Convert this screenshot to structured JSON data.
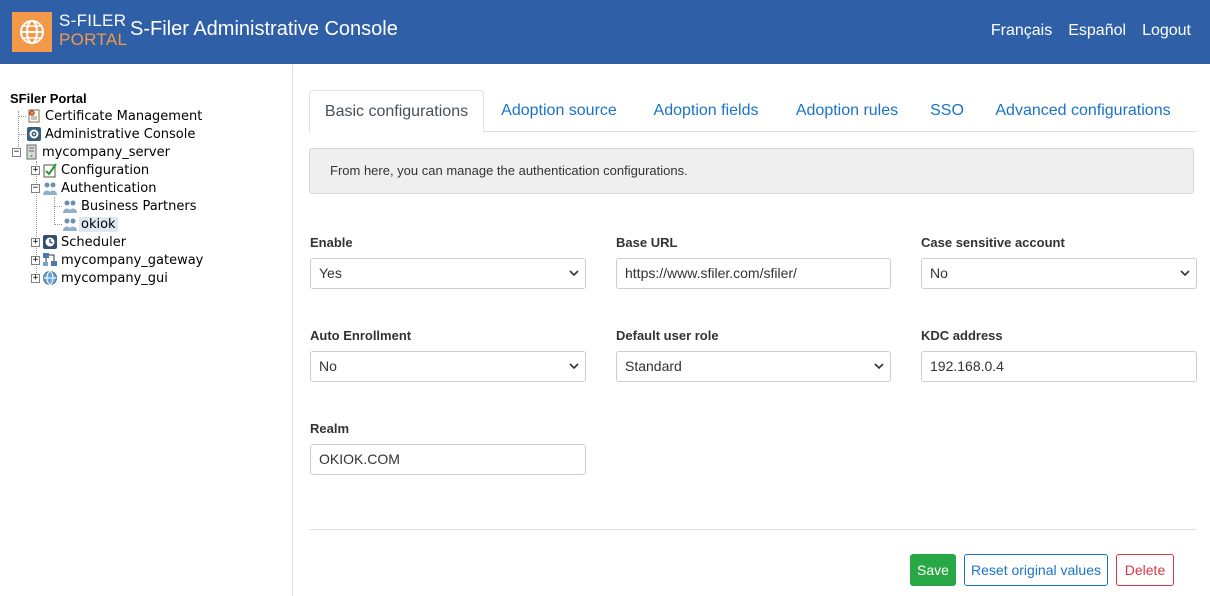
{
  "header": {
    "logo_line1": "S-FILER",
    "logo_line2": "PORTAL",
    "title": "S-Filer Administrative Console",
    "nav": [
      "Français",
      "Español",
      "Logout"
    ]
  },
  "tree": {
    "root": "SFiler Portal",
    "nodes": {
      "cert": "Certificate Management",
      "admin": "Administrative Console",
      "server": "mycompany_server",
      "config": "Configuration",
      "auth": "Authentication",
      "partners": "Business Partners",
      "okiok": "okiok",
      "scheduler": "Scheduler",
      "gateway": "mycompany_gateway",
      "gui": "mycompany_gui"
    }
  },
  "tabs": [
    "Basic configurations",
    "Adoption source",
    "Adoption fields",
    "Adoption rules",
    "SSO",
    "Advanced configurations"
  ],
  "info": "From here, you can manage the authentication configurations.",
  "form": {
    "enable": {
      "label": "Enable",
      "value": "Yes"
    },
    "base_url": {
      "label": "Base URL",
      "value": "https://www.sfiler.com/sfiler/"
    },
    "case_sensitive": {
      "label": "Case sensitive account",
      "value": "No"
    },
    "auto_enrollment": {
      "label": "Auto Enrollment",
      "value": "No"
    },
    "default_role": {
      "label": "Default user role",
      "value": "Standard"
    },
    "kdc": {
      "label": "KDC address",
      "value": "192.168.0.4"
    },
    "realm": {
      "label": "Realm",
      "value": "OKIOK.COM"
    }
  },
  "buttons": {
    "save": "Save",
    "reset": "Reset original values",
    "delete": "Delete"
  },
  "colors": {
    "header_bg": "#2f5fa6",
    "accent_orange": "#f2994a",
    "link_blue": "#1a73c7",
    "save_green": "#28a745",
    "delete_red": "#dc3545"
  }
}
